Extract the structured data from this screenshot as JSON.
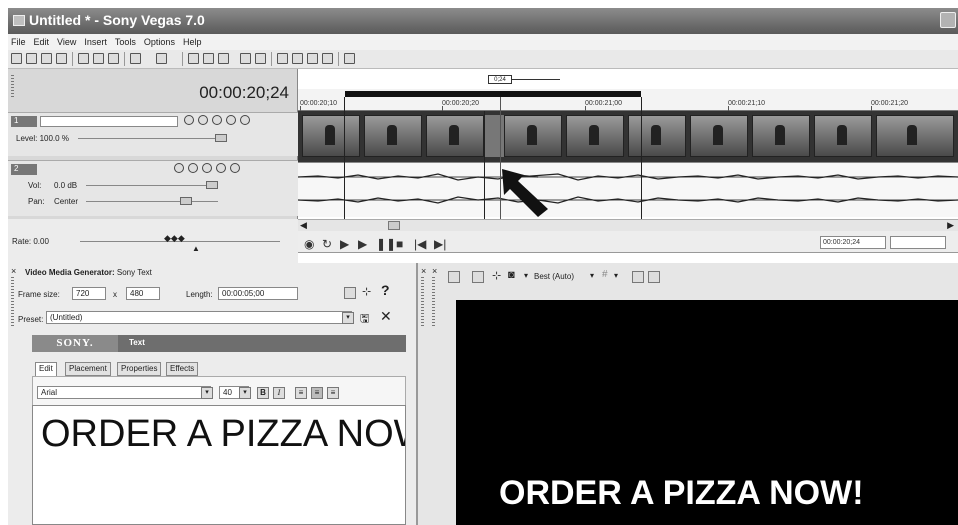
{
  "window": {
    "title": "Untitled * - Sony Vegas 7.0"
  },
  "menu": [
    "File",
    "Edit",
    "View",
    "Insert",
    "Tools",
    "Options",
    "Help"
  ],
  "timeline": {
    "current_time": "00:00:20;24",
    "cursor_flag": "0;24",
    "ruler_labels": [
      "00:00:20;10",
      "00:00:20;20",
      "00:00:21;00",
      "00:00:21;10",
      "00:00:21;20"
    ],
    "video_track": {
      "number": "1",
      "level_label": "Level: 100.0 %"
    },
    "audio_track": {
      "number": "2",
      "vol_label": "Vol:",
      "vol_value": "0.0 dB",
      "pan_label": "Pan:",
      "pan_value": "Center"
    },
    "rate_label": "Rate: 0.00",
    "end_time": "00:00:20;24"
  },
  "generator": {
    "title_bold": "Video Media Generator:",
    "title_rest": " Sony Text",
    "frame_size_label": "Frame size:",
    "width": "720",
    "x": "x",
    "height": "480",
    "length_label": "Length:",
    "length": "00:00:05;00",
    "preset_label": "Preset:",
    "preset": "(Untitled)",
    "brand": "SONY.",
    "plugin": "Text",
    "tabs": [
      "Edit",
      "Placement",
      "Properties",
      "Effects"
    ],
    "font": "Arial",
    "size": "40",
    "bold": "B",
    "italic": "I",
    "text": "ORDER A PIZZA NOW!",
    "help": "?"
  },
  "preview": {
    "quality": "Best (Auto)",
    "overlay_text": "ORDER A PIZZA NOW!"
  }
}
